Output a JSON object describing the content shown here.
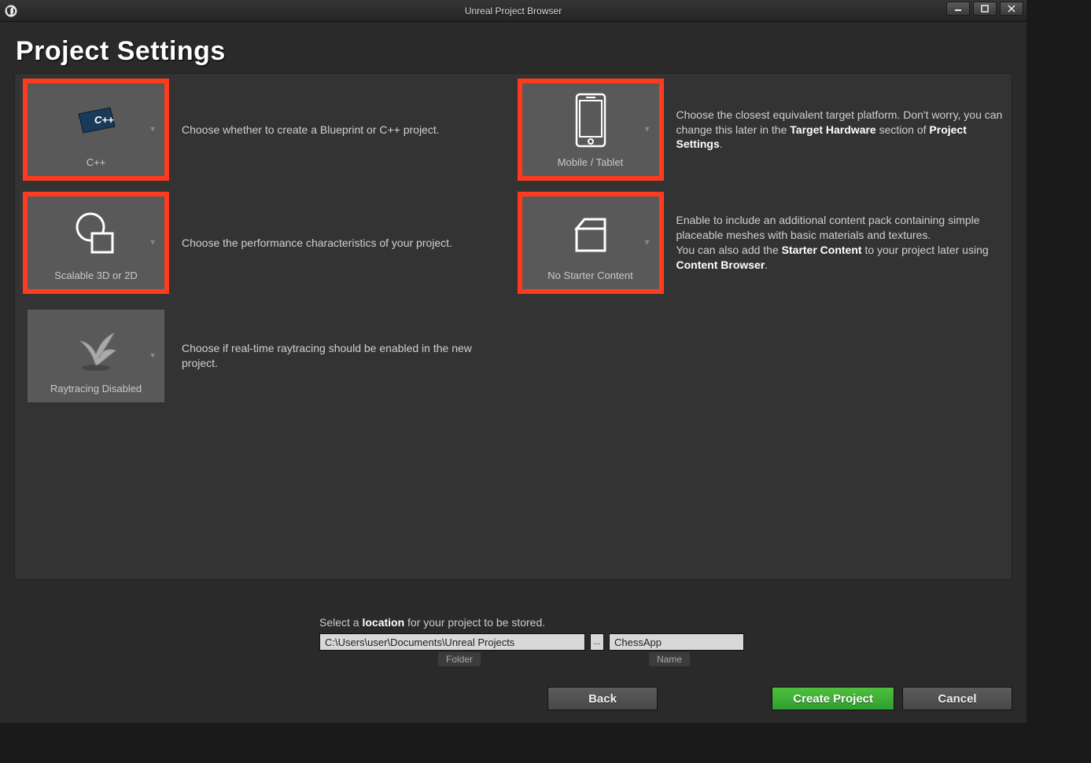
{
  "window": {
    "title": "Unreal Project Browser"
  },
  "header": {
    "title": "Project Settings"
  },
  "tiles": {
    "cpp": {
      "label": "C++",
      "desc": "Choose whether to create a Blueprint or C++ project."
    },
    "platform": {
      "label": "Mobile / Tablet",
      "desc_pre": "Choose the closest equivalent target platform. Don't worry, you can change this later in the ",
      "desc_b1": "Target Hardware",
      "desc_mid": " section of ",
      "desc_b2": "Project Settings",
      "desc_post": "."
    },
    "quality": {
      "label": "Scalable 3D or 2D",
      "desc": "Choose the performance characteristics of your project."
    },
    "starter": {
      "label": "No Starter Content",
      "desc_line1": "Enable to include an additional content pack containing simple placeable meshes with basic materials and textures.",
      "desc_pre": "You can also add the ",
      "desc_b1": "Starter Content",
      "desc_mid": " to your project later using ",
      "desc_b2": "Content Browser",
      "desc_post": "."
    },
    "raytracing": {
      "label": "Raytracing Disabled",
      "desc": "Choose if real-time raytracing should be enabled in the new project."
    }
  },
  "location": {
    "prompt_pre": "Select a ",
    "prompt_b": "location",
    "prompt_post": " for your project to be stored.",
    "folder_value": "C:\\Users\\user\\Documents\\Unreal Projects",
    "folder_label": "Folder",
    "name_value": "ChessApp",
    "name_label": "Name",
    "browse": "..."
  },
  "buttons": {
    "back": "Back",
    "create": "Create Project",
    "cancel": "Cancel"
  }
}
